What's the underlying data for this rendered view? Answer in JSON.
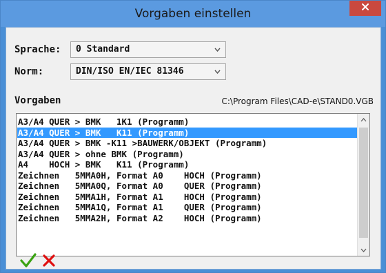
{
  "window": {
    "title": "Vorgaben einstellen"
  },
  "form": {
    "sprache_label": "Sprache:",
    "sprache_value": "0 Standard",
    "norm_label": "Norm:",
    "norm_value": "DIN/ISO EN/IEC 81346",
    "vorgaben_label": "Vorgaben",
    "file_path": "C:\\Program Files\\CAD-e\\STAND0.VGB"
  },
  "list": {
    "items": [
      "A3/A4 QUER > BMK   1K1 (Programm)",
      "A3/A4 QUER > BMK   K11 (Programm)",
      "A3/A4 QUER > BMK -K11 >BAUWERK/OBJEKT (Programm)",
      "A3/A4 QUER > ohne BMK (Programm)",
      "A4    HOCH > BMK   K11 (Programm)",
      "Zeichnen   5MMA0H, Format A0    HOCH (Programm)",
      "Zeichnen   5MMA0Q, Format A0    QUER (Programm)",
      "Zeichnen   5MMA1H, Format A1    HOCH (Programm)",
      "Zeichnen   5MMA1Q, Format A1    QUER (Programm)",
      "Zeichnen   5MMA2H, Format A2    HOCH (Programm)"
    ],
    "selected_index": 1
  },
  "colors": {
    "titlebar": "#5b9ae0",
    "close": "#c9493f",
    "selection": "#3399ff",
    "ok": "#3aa312",
    "cancel": "#e01010"
  },
  "icons": {
    "close": "close-icon",
    "combo_arrow": "chevron-down-icon",
    "ok": "checkmark-icon",
    "cancel": "cross-icon"
  }
}
